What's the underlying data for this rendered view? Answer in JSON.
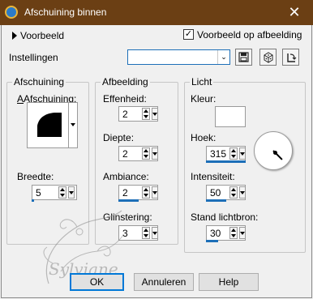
{
  "window": {
    "title": "Afschuining binnen",
    "close_glyph": "✕"
  },
  "preview": {
    "expander_label": "Voorbeeld",
    "checkbox_label": "Voorbeeld op afbeelding",
    "checkbox_checked": true,
    "check_glyph": "✓"
  },
  "settings": {
    "label": "Instellingen",
    "combo_value": ""
  },
  "groups": {
    "bevel": {
      "title": "Afschuining",
      "bevel_label": "Afschuining:",
      "width_label": "Breedte:",
      "width_value": "5",
      "width_slider_fraction": 0.05
    },
    "image": {
      "title": "Afbeelding",
      "smoothness_label": "Effenheid:",
      "smoothness_value": "2",
      "depth_label": "Diepte:",
      "depth_value": "2",
      "ambience_label": "Ambiance:",
      "ambience_value": "2",
      "ambience_slider_fraction": 0.52,
      "shininess_label": "Glinstering:",
      "shininess_value": "3"
    },
    "light": {
      "title": "Licht",
      "color_label": "Kleur:",
      "color_value": "#ffffff",
      "angle_label": "Hoek:",
      "angle_value": "315",
      "angle_degrees": 315,
      "intensity_label": "Intensiteit:",
      "intensity_value": "50",
      "intensity_slider_fraction": 0.5,
      "elevation_label": "Stand lichtbron:",
      "elevation_value": "30",
      "elevation_slider_fraction": 0.3
    }
  },
  "buttons": {
    "ok": "OK",
    "cancel": "Annuleren",
    "help": "Help"
  },
  "watermark_text": "Sylviane",
  "colors": {
    "titlebar": "#6b3f14",
    "accent": "#1d6fb8"
  }
}
